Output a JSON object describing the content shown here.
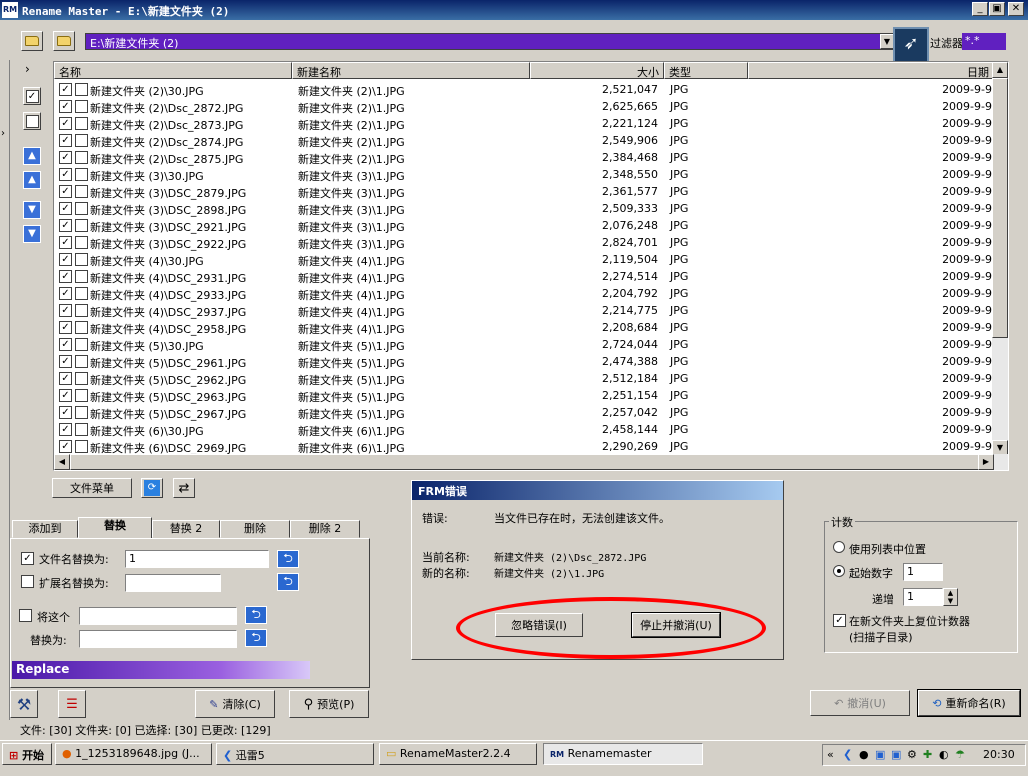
{
  "window": {
    "title": "Rename Master - E:\\新建文件夹 (2)",
    "logo": "RM",
    "min": "_",
    "max": "▣",
    "close": "✕"
  },
  "pathbar": {
    "path": "E:\\新建文件夹 (2)",
    "filter_label": "过滤器",
    "filter_value": "*.*"
  },
  "list": {
    "headers": {
      "name": "名称",
      "newname": "新建名称",
      "size": "大小",
      "type": "类型",
      "date": "日期"
    },
    "rows": [
      {
        "name": "新建文件夹 (2)\\30.JPG",
        "newname": "新建文件夹 (2)\\1.JPG",
        "size": "2,521,047",
        "type": "JPG",
        "date": "2009-9-9"
      },
      {
        "name": "新建文件夹 (2)\\Dsc_2872.JPG",
        "newname": "新建文件夹 (2)\\1.JPG",
        "size": "2,625,665",
        "type": "JPG",
        "date": "2009-9-9"
      },
      {
        "name": "新建文件夹 (2)\\Dsc_2873.JPG",
        "newname": "新建文件夹 (2)\\1.JPG",
        "size": "2,221,124",
        "type": "JPG",
        "date": "2009-9-9"
      },
      {
        "name": "新建文件夹 (2)\\Dsc_2874.JPG",
        "newname": "新建文件夹 (2)\\1.JPG",
        "size": "2,549,906",
        "type": "JPG",
        "date": "2009-9-9"
      },
      {
        "name": "新建文件夹 (2)\\Dsc_2875.JPG",
        "newname": "新建文件夹 (2)\\1.JPG",
        "size": "2,384,468",
        "type": "JPG",
        "date": "2009-9-9"
      },
      {
        "name": "新建文件夹 (3)\\30.JPG",
        "newname": "新建文件夹 (3)\\1.JPG",
        "size": "2,348,550",
        "type": "JPG",
        "date": "2009-9-9"
      },
      {
        "name": "新建文件夹 (3)\\DSC_2879.JPG",
        "newname": "新建文件夹 (3)\\1.JPG",
        "size": "2,361,577",
        "type": "JPG",
        "date": "2009-9-9"
      },
      {
        "name": "新建文件夹 (3)\\DSC_2898.JPG",
        "newname": "新建文件夹 (3)\\1.JPG",
        "size": "2,509,333",
        "type": "JPG",
        "date": "2009-9-9"
      },
      {
        "name": "新建文件夹 (3)\\DSC_2921.JPG",
        "newname": "新建文件夹 (3)\\1.JPG",
        "size": "2,076,248",
        "type": "JPG",
        "date": "2009-9-9"
      },
      {
        "name": "新建文件夹 (3)\\DSC_2922.JPG",
        "newname": "新建文件夹 (3)\\1.JPG",
        "size": "2,824,701",
        "type": "JPG",
        "date": "2009-9-9"
      },
      {
        "name": "新建文件夹 (4)\\30.JPG",
        "newname": "新建文件夹 (4)\\1.JPG",
        "size": "2,119,504",
        "type": "JPG",
        "date": "2009-9-9"
      },
      {
        "name": "新建文件夹 (4)\\DSC_2931.JPG",
        "newname": "新建文件夹 (4)\\1.JPG",
        "size": "2,274,514",
        "type": "JPG",
        "date": "2009-9-9"
      },
      {
        "name": "新建文件夹 (4)\\DSC_2933.JPG",
        "newname": "新建文件夹 (4)\\1.JPG",
        "size": "2,204,792",
        "type": "JPG",
        "date": "2009-9-9"
      },
      {
        "name": "新建文件夹 (4)\\DSC_2937.JPG",
        "newname": "新建文件夹 (4)\\1.JPG",
        "size": "2,214,775",
        "type": "JPG",
        "date": "2009-9-9"
      },
      {
        "name": "新建文件夹 (4)\\DSC_2958.JPG",
        "newname": "新建文件夹 (4)\\1.JPG",
        "size": "2,208,684",
        "type": "JPG",
        "date": "2009-9-9"
      },
      {
        "name": "新建文件夹 (5)\\30.JPG",
        "newname": "新建文件夹 (5)\\1.JPG",
        "size": "2,724,044",
        "type": "JPG",
        "date": "2009-9-9"
      },
      {
        "name": "新建文件夹 (5)\\DSC_2961.JPG",
        "newname": "新建文件夹 (5)\\1.JPG",
        "size": "2,474,388",
        "type": "JPG",
        "date": "2009-9-9"
      },
      {
        "name": "新建文件夹 (5)\\DSC_2962.JPG",
        "newname": "新建文件夹 (5)\\1.JPG",
        "size": "2,512,184",
        "type": "JPG",
        "date": "2009-9-9"
      },
      {
        "name": "新建文件夹 (5)\\DSC_2963.JPG",
        "newname": "新建文件夹 (5)\\1.JPG",
        "size": "2,251,154",
        "type": "JPG",
        "date": "2009-9-9"
      },
      {
        "name": "新建文件夹 (5)\\DSC_2967.JPG",
        "newname": "新建文件夹 (5)\\1.JPG",
        "size": "2,257,042",
        "type": "JPG",
        "date": "2009-9-9"
      },
      {
        "name": "新建文件夹 (6)\\30.JPG",
        "newname": "新建文件夹 (6)\\1.JPG",
        "size": "2,458,144",
        "type": "JPG",
        "date": "2009-9-9"
      },
      {
        "name": "新建文件夹 (6)\\DSC_2969.JPG",
        "newname": "新建文件夹 (6)\\1.JPG",
        "size": "2,290,269",
        "type": "JPG",
        "date": "2009-9-9"
      }
    ]
  },
  "filemenu_label": "文件菜单",
  "tabs": [
    "添加到",
    "替换",
    "替换 2",
    "删除",
    "删除 2"
  ],
  "replace_panel": {
    "filename_label": "文件名替换为:",
    "filename_value": "1",
    "ext_label": "扩展名替换为:",
    "ext_value": "",
    "this_label": "将这个",
    "this_value": "",
    "with_label": "替换为:",
    "with_value": "",
    "banner": "Replace"
  },
  "buttons": {
    "clear": "清除(C)",
    "preview": "预览(P)",
    "undo": "撤消(U)",
    "rename": "重新命名(R)"
  },
  "dialog": {
    "title": "FRM错误",
    "error_label": "错误:",
    "error_text": "当文件已存在时，无法创建该文件。",
    "current_label": "当前名称:",
    "current_value": "新建文件夹 (2)\\Dsc_2872.JPG",
    "new_label": "新的名称:",
    "new_value": "新建文件夹 (2)\\1.JPG",
    "ignore_btn": "忽略错误(I)",
    "stop_btn": "停止并撤消(U)"
  },
  "counter": {
    "title": "计数",
    "use_list": "使用列表中位置",
    "start_label": "起始数字",
    "start_value": "1",
    "step_label": "递增",
    "step_value": "1",
    "reset_label": "在新文件夹上复位计数器",
    "reset_sub": "(扫描子目录)"
  },
  "status": "文件: [30] 文件夹: [0] 已选择: [30] 已更改: [129]",
  "taskbar": {
    "start": "开始",
    "tasks": [
      "1_1253189648.jpg (J...",
      "迅雷5",
      "RenameMaster2.2.4",
      "Renamemaster"
    ],
    "clock": "20:30"
  }
}
